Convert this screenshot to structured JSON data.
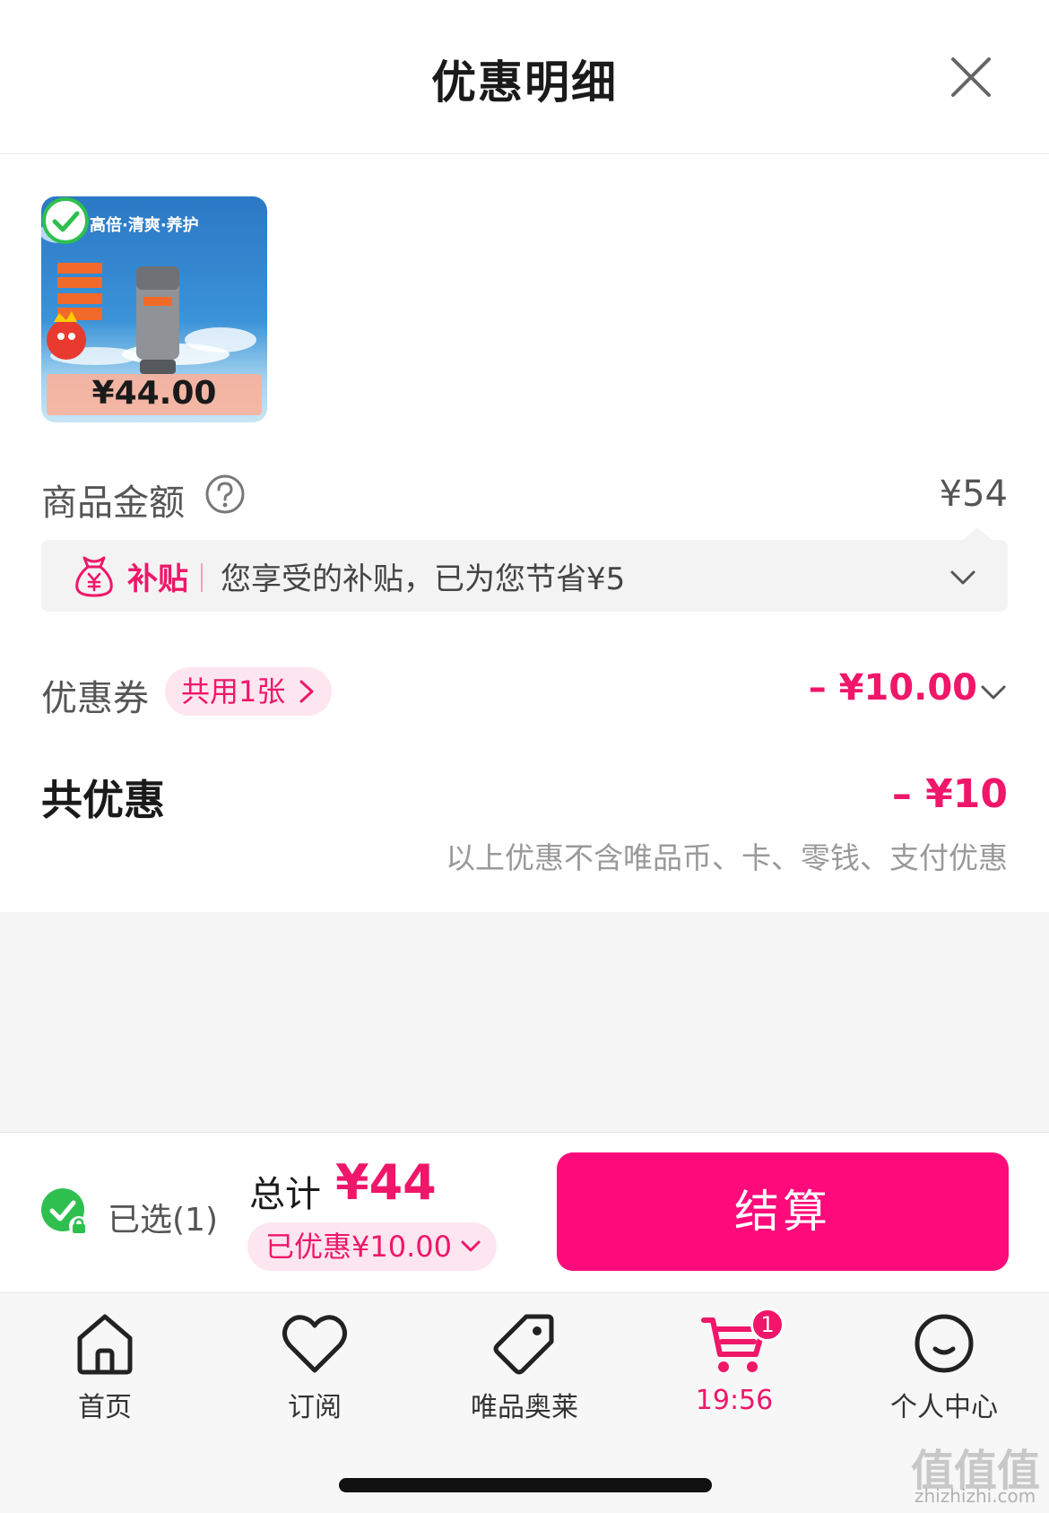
{
  "header": {
    "title": "优惠明细",
    "close_icon": "close-icon"
  },
  "product": {
    "headline": "高倍·清爽·养护",
    "price": "¥44.00",
    "selected": true
  },
  "amount": {
    "label": "商品金额",
    "value": "¥54"
  },
  "subsidy": {
    "tag": "补贴",
    "text": "您享受的补贴，已为您节省¥5"
  },
  "coupon": {
    "label": "优惠券",
    "pill": "共用1张",
    "value": "– ¥10.00"
  },
  "total_discount": {
    "label": "共优惠",
    "value": "– ¥10",
    "note": "以上优惠不含唯品币、卡、零钱、支付优惠"
  },
  "checkout": {
    "selected_text": "已选(1)",
    "total_label": "总计",
    "total_value": "¥44",
    "saved_text": "已优惠¥10.00",
    "pay_label": "结算"
  },
  "tabbar": {
    "items": [
      {
        "label": "首页",
        "icon": "home-icon"
      },
      {
        "label": "订阅",
        "icon": "heart-icon"
      },
      {
        "label": "唯品奥莱",
        "icon": "tag-icon"
      },
      {
        "label": "19:56",
        "icon": "cart-icon",
        "badge": "1",
        "active": true
      },
      {
        "label": "个人中心",
        "icon": "smile-icon"
      }
    ]
  },
  "watermark": {
    "text": "值值值",
    "sub": "zhizhizhi.com"
  },
  "colors": {
    "accent": "#f0166a",
    "pay_button": "#ff0a7a",
    "check_green": "#2fbf4f"
  }
}
